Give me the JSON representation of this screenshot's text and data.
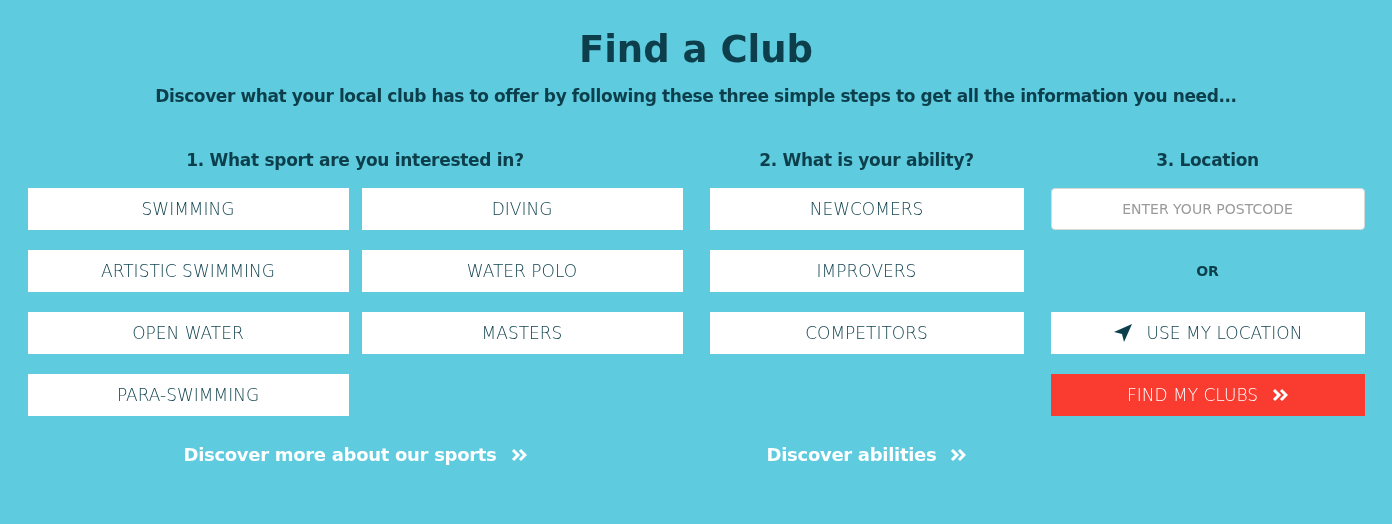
{
  "title": "Find a Club",
  "subtitle": "Discover what your local club has to offer by following these three simple steps to get all the information you need...",
  "sports": {
    "heading": "1. What sport are you interested in?",
    "options": [
      "SWIMMING",
      "DIVING",
      "ARTISTIC SWIMMING",
      "WATER POLO",
      "OPEN WATER",
      "MASTERS",
      "PARA-SWIMMING"
    ],
    "link": "Discover more about our sports"
  },
  "ability": {
    "heading": "2. What is your ability?",
    "options": [
      "NEWCOMERS",
      "IMPROVERS",
      "COMPETITORS"
    ],
    "link": "Discover abilities"
  },
  "location": {
    "heading": "3. Location",
    "postcode": {
      "placeholder": "ENTER YOUR POSTCODE"
    },
    "separator": "OR",
    "use_location": "USE MY LOCATION",
    "submit": "FIND MY CLUBS"
  }
}
